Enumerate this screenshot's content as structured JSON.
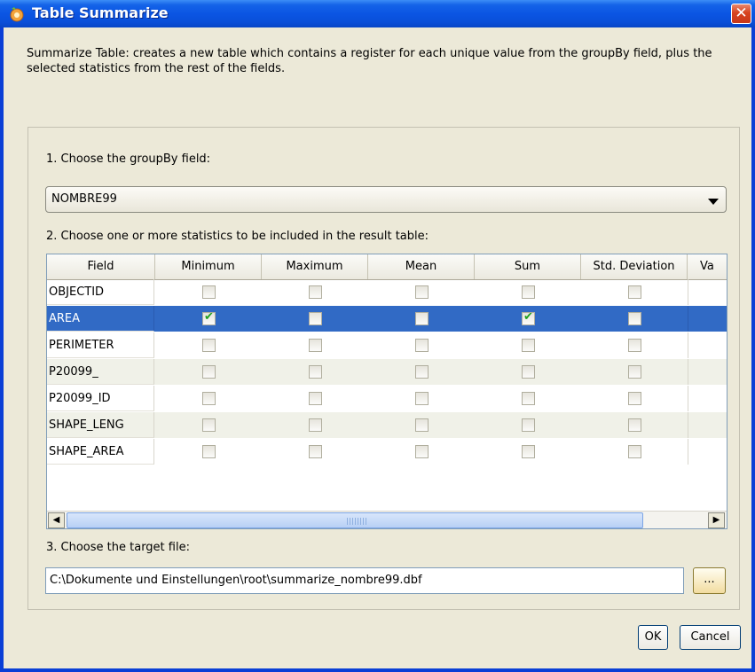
{
  "window": {
    "title": "Table Summarize",
    "close_glyph": "✕"
  },
  "description": "Summarize Table: creates a new table which contains a register for each unique value from the groupBy field, plus the selected statistics from the rest of the fields.",
  "step1": {
    "label": "1. Choose the groupBy field:",
    "selected": "NOMBRE99"
  },
  "step2": {
    "label": "2. Choose one or more statistics to be included in the result table:",
    "columns": [
      "Field",
      "Minimum",
      "Maximum",
      "Mean",
      "Sum",
      "Std. Deviation",
      "Va"
    ],
    "rows": [
      {
        "field": "OBJECTID",
        "checks": [
          false,
          false,
          false,
          false,
          false
        ]
      },
      {
        "field": "AREA",
        "checks": [
          true,
          false,
          false,
          true,
          false
        ],
        "selected": true
      },
      {
        "field": "PERIMETER",
        "checks": [
          false,
          false,
          false,
          false,
          false
        ]
      },
      {
        "field": "P20099_",
        "checks": [
          false,
          false,
          false,
          false,
          false
        ]
      },
      {
        "field": "P20099_ID",
        "checks": [
          false,
          false,
          false,
          false,
          false
        ]
      },
      {
        "field": "SHAPE_LENG",
        "checks": [
          false,
          false,
          false,
          false,
          false
        ]
      },
      {
        "field": "SHAPE_AREA",
        "checks": [
          false,
          false,
          false,
          false,
          false
        ]
      }
    ]
  },
  "step3": {
    "label": "3. Choose the target file:",
    "value": "C:\\Dokumente und Einstellungen\\root\\summarize_nombre99.dbf",
    "browse_label": "..."
  },
  "buttons": {
    "ok": "OK",
    "cancel": "Cancel"
  },
  "colors": {
    "titlebar": "#0a55e3",
    "selection": "#316ac5",
    "background": "#ece9d8",
    "check": "#21a121"
  }
}
